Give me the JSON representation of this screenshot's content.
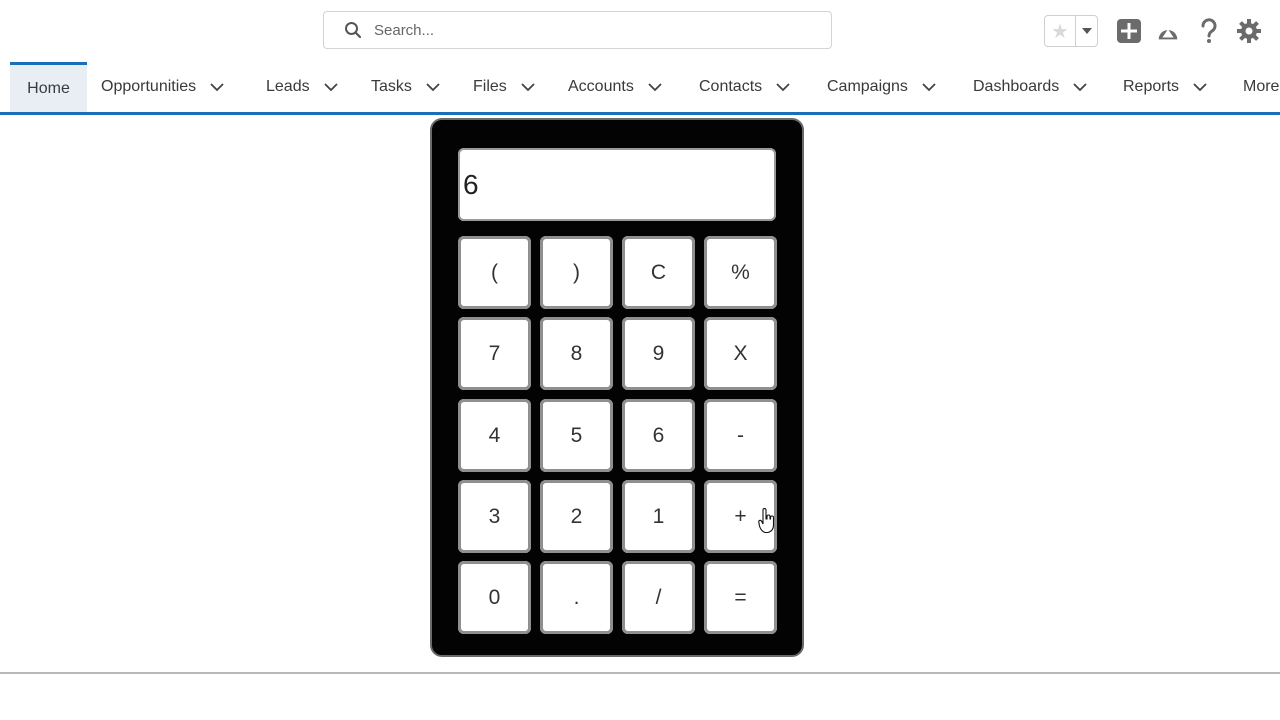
{
  "search": {
    "placeholder": "Search..."
  },
  "utility_icons": [
    "favorites-star-icon",
    "add-icon",
    "trailhead-icon",
    "help-icon",
    "setup-gear-icon"
  ],
  "nav": {
    "items": [
      {
        "label": "Home",
        "active": true,
        "has_dropdown": false
      },
      {
        "label": "Opportunities",
        "has_dropdown": true
      },
      {
        "label": "Leads",
        "has_dropdown": true
      },
      {
        "label": "Tasks",
        "has_dropdown": true
      },
      {
        "label": "Files",
        "has_dropdown": true
      },
      {
        "label": "Accounts",
        "has_dropdown": true
      },
      {
        "label": "Contacts",
        "has_dropdown": true
      },
      {
        "label": "Campaigns",
        "has_dropdown": true
      },
      {
        "label": "Dashboards",
        "has_dropdown": true
      },
      {
        "label": "Reports",
        "has_dropdown": true
      },
      {
        "label": "More",
        "has_dropdown": false
      }
    ]
  },
  "calculator": {
    "display": "6",
    "keys": [
      [
        "(",
        ")",
        "C",
        "%"
      ],
      [
        "7",
        "8",
        "9",
        "X"
      ],
      [
        "4",
        "5",
        "6",
        "-"
      ],
      [
        "3",
        "2",
        "1",
        "+"
      ],
      [
        "0",
        ".",
        "/",
        "="
      ]
    ]
  },
  "colors": {
    "accent": "#1b6fb8",
    "calculator_body": "#030303"
  }
}
